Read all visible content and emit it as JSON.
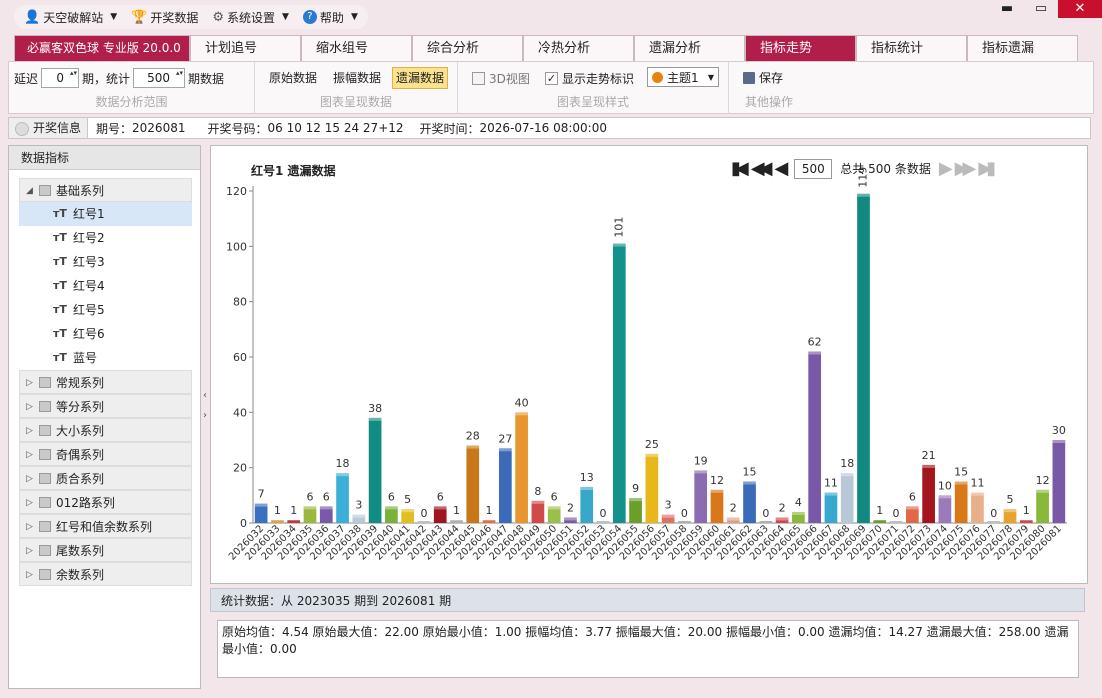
{
  "menu": {
    "items": [
      {
        "label": "天空破解站",
        "icon": "user-icon",
        "dropdown": true
      },
      {
        "label": "开奖数据",
        "icon": "trophy-icon",
        "dropdown": false
      },
      {
        "label": "系统设置",
        "icon": "settings-icon",
        "dropdown": true
      },
      {
        "label": "帮助",
        "icon": "help-icon",
        "dropdown": true
      }
    ]
  },
  "window": {
    "minimize": "▬",
    "maximize": "▭",
    "close": "✕"
  },
  "tabs": {
    "brand": "必赢客双色球 专业版 20.0.0",
    "items": [
      "计划追号",
      "缩水组号",
      "综合分析",
      "冷热分析",
      "遗漏分析",
      "指标走势",
      "指标统计",
      "指标遗漏"
    ],
    "active": "指标走势"
  },
  "toolbar": {
    "delay_label": "延迟",
    "delay_value": "0",
    "period_label": "期，统计",
    "count_value": "500",
    "count_label": "期数据",
    "group1_caption": "数据分析范围",
    "btn_raw": "原始数据",
    "btn_amp": "振幅数据",
    "btn_miss": "遗漏数据",
    "group2_caption": "图表呈现数据",
    "chk_3d": "3D视图",
    "chk_trend": "显示走势标识",
    "theme": "主题1",
    "group3_caption": "图表呈现样式",
    "save": "保存",
    "group4_caption": "其他操作"
  },
  "infobar": {
    "tag": "开奖信息",
    "period_label": "期号：",
    "period": "2026081",
    "numbers_label": "开奖号码：",
    "numbers": "06 10 12 15 24 27+12",
    "time_label": "开奖时间：",
    "time": "2026-07-16 08:00:00"
  },
  "left_panel": {
    "header": "数据指标",
    "groups": [
      {
        "label": "基础系列",
        "expanded": true,
        "children": [
          "红号1",
          "红号2",
          "红号3",
          "红号4",
          "红号5",
          "红号6",
          "蓝号"
        ]
      },
      {
        "label": "常规系列",
        "expanded": false
      },
      {
        "label": "等分系列",
        "expanded": false
      },
      {
        "label": "大小系列",
        "expanded": false
      },
      {
        "label": "奇偶系列",
        "expanded": false
      },
      {
        "label": "质合系列",
        "expanded": false
      },
      {
        "label": "012路系列",
        "expanded": false
      },
      {
        "label": "红号和值余数系列",
        "expanded": false
      },
      {
        "label": "尾数系列",
        "expanded": false
      },
      {
        "label": "余数系列",
        "expanded": false
      }
    ],
    "selected": "红号1"
  },
  "chart_header": {
    "title": "红号1 遗漏数据",
    "page_size": "500",
    "total_text": "总共 500 条数据"
  },
  "chart_data": {
    "type": "bar",
    "title": "红号1 遗漏数据",
    "categories": [
      "2026032",
      "2026033",
      "2026034",
      "2026035",
      "2026036",
      "2026037",
      "2026038",
      "2026039",
      "2026040",
      "2026041",
      "2026042",
      "2026043",
      "2026044",
      "2026045",
      "2026046",
      "2026047",
      "2026048",
      "2026049",
      "2026050",
      "2026051",
      "2026052",
      "2026053",
      "2026054",
      "2026055",
      "2026056",
      "2026057",
      "2026058",
      "2026059",
      "2026060",
      "2026061",
      "2026062",
      "2026063",
      "2026064",
      "2026065",
      "2026066",
      "2026067",
      "2026068",
      "2026069",
      "2026070",
      "2026071",
      "2026072",
      "2026073",
      "2026074",
      "2026075",
      "2026076",
      "2026077",
      "2026078",
      "2026079",
      "2026080",
      "2026081"
    ],
    "values": [
      7,
      1,
      1,
      6,
      6,
      18,
      3,
      38,
      6,
      5,
      0,
      6,
      1,
      28,
      1,
      27,
      40,
      8,
      6,
      2,
      13,
      0,
      101,
      9,
      25,
      3,
      0,
      19,
      12,
      2,
      15,
      0,
      2,
      4,
      62,
      11,
      18,
      119,
      1,
      0,
      6,
      21,
      10,
      15,
      11,
      0,
      5,
      1,
      12,
      30
    ],
    "colors": [
      "#3b6fc0",
      "#e0a050",
      "#c03a3a",
      "#9ab83c",
      "#7a5aa8",
      "#3ab0d8",
      "#b8c8d8",
      "#138c84",
      "#7ab03c",
      "#e0c020",
      "#c0c0c0",
      "#a0161e",
      "#b0b0b0",
      "#c8781a",
      "#e07040",
      "#3a6ab8",
      "#e8962e",
      "#d04a4a",
      "#9ac04a",
      "#7a5aa8",
      "#38a8c8",
      "#c0c0c0",
      "#14918a",
      "#6aa02a",
      "#e8b81a",
      "#e07060",
      "#b0b0b0",
      "#8c6cb0",
      "#d8781a",
      "#e0a080",
      "#3a6ab8",
      "#b0b0b0",
      "#d04a4a",
      "#8ab83a",
      "#7a58a8",
      "#38a8d0",
      "#b8c8d8",
      "#118880",
      "#6aa02a",
      "#c0c0c0",
      "#e06848",
      "#a3161e",
      "#9a7ab8",
      "#d87818",
      "#e8b08a",
      "#c0c0c0",
      "#e8a22e",
      "#d04a4a",
      "#8ab83a",
      "#7a58a8"
    ],
    "ylim": [
      0,
      120
    ],
    "yticks": [
      0,
      20,
      40,
      60,
      80,
      100,
      120
    ],
    "data_labels": true,
    "grid": false
  },
  "stats": {
    "header": "统计数据：从 2023035 期到 2026081 期",
    "line": "原始均值：4.54    原始最大值：22.00    原始最小值：1.00    振幅均值：3.77    振幅最大值：20.00    振幅最小值：0.00    遗漏均值：14.27    遗漏最大值：258.00    遗漏最小值：0.00"
  }
}
